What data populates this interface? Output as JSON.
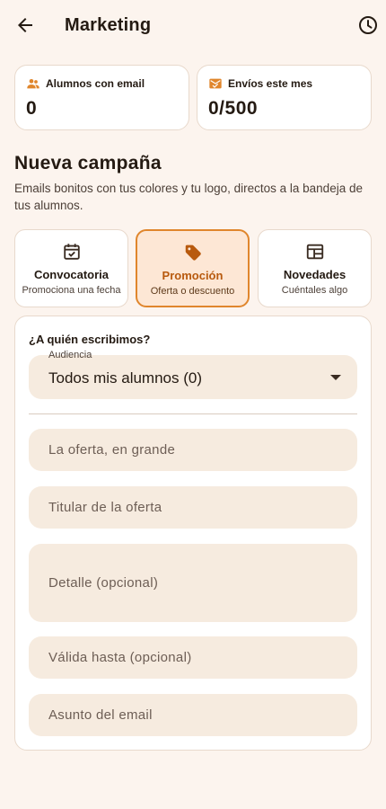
{
  "appbar": {
    "title": "Marketing",
    "back_icon": "arrow-back-icon",
    "history_icon": "history-icon"
  },
  "stats": [
    {
      "label": "Alumnos con email",
      "value": "0",
      "icon": "people-icon"
    },
    {
      "label": "Envíos este mes",
      "value": "0/500",
      "icon": "mark-email-icon"
    }
  ],
  "section": {
    "title": "Nueva campaña",
    "description": "Emails bonitos con tus colores y tu logo, directos a la bandeja de tus alumnos."
  },
  "templates": [
    {
      "title": "Convocatoria",
      "subtitle": "Promociona una fecha",
      "icon": "event-available-icon",
      "selected": false
    },
    {
      "title": "Promoción",
      "subtitle": "Oferta o descuento",
      "icon": "sell-tag-icon",
      "selected": true
    },
    {
      "title": "Novedades",
      "subtitle": "Cuéntales algo",
      "icon": "newspaper-icon",
      "selected": false
    }
  ],
  "form": {
    "question": "¿A quién escribimos?",
    "audience_label": "Audiencia",
    "audience_value": "Todos mis alumnos (0)",
    "fields": [
      {
        "placeholder": "La oferta, en grande"
      },
      {
        "placeholder": "Titular de la oferta"
      },
      {
        "placeholder": "Detalle (opcional)"
      },
      {
        "placeholder": "Válida hasta (opcional)"
      },
      {
        "placeholder": "Asunto del email"
      }
    ]
  },
  "colors": {
    "background": "#fcf4ee",
    "accent": "#e0862c",
    "selected_tile_bg": "#fde7d5",
    "field_bg": "#f6ebdf",
    "text": "#241a12"
  }
}
